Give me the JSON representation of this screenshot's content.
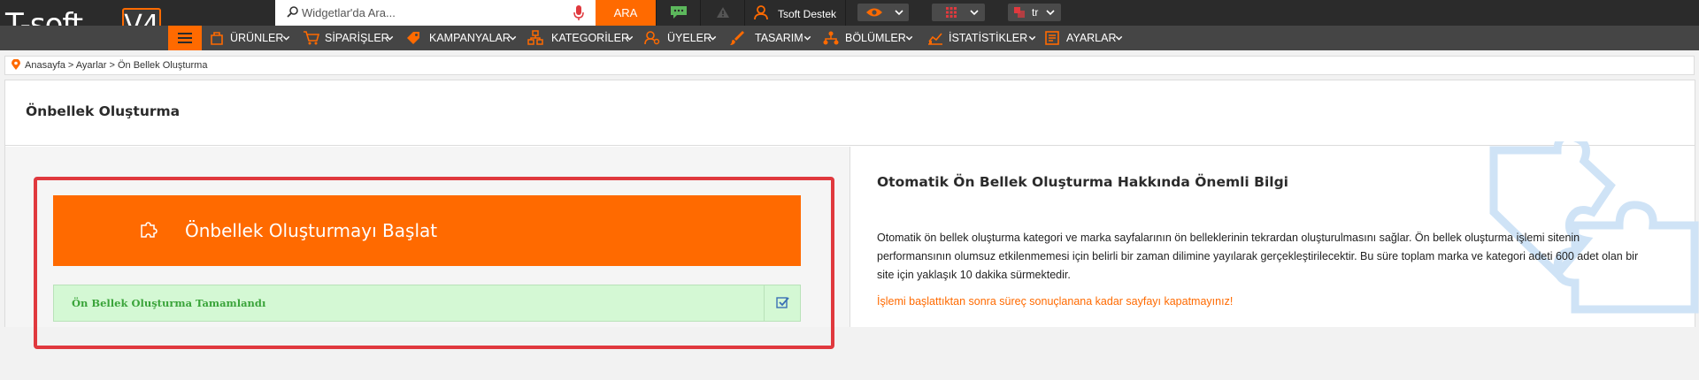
{
  "brand": {
    "logo_text": "T-soft",
    "logo_version": "V4",
    "accent_color": "#ff6a00"
  },
  "topbar": {
    "search": {
      "placeholder": "Widgetlar'da Ara...",
      "value": "",
      "button_label": "ARA"
    },
    "icons": [
      "search-icon",
      "microphone-icon",
      "chat-icon",
      "alert-icon",
      "user-icon",
      "eye-icon",
      "grid-icon",
      "language-flag-icon"
    ],
    "support_name": "Tsoft Destek",
    "language": "tr"
  },
  "nav": {
    "items": [
      {
        "label": "ÜRÜNLER",
        "icon": "products-icon"
      },
      {
        "label": "SİPARİŞLER",
        "icon": "cart-icon"
      },
      {
        "label": "KAMPANYALAR",
        "icon": "tag-icon"
      },
      {
        "label": "KATEGORİLER",
        "icon": "category-icon"
      },
      {
        "label": "ÜYELER",
        "icon": "members-icon"
      },
      {
        "label": "TASARIM",
        "icon": "design-icon"
      },
      {
        "label": "BÖLÜMLER",
        "icon": "sections-icon"
      },
      {
        "label": "İSTATİSTİKLER",
        "icon": "stats-icon"
      },
      {
        "label": "AYARLAR",
        "icon": "settings-icon"
      }
    ]
  },
  "breadcrumb": {
    "text": "Anasayfa > Ayarlar > Ön Bellek Oluşturma"
  },
  "page": {
    "title": "Önbellek Oluşturma",
    "start_button_label": "Önbellek Oluşturmayı Başlat",
    "status_text": "Ön Bellek Oluşturma Tamamlandı",
    "status_color": "#3aa43a",
    "highlight_color": "#e0393e"
  },
  "info": {
    "title": "Otomatik Ön Bellek Oluşturma Hakkında Önemli Bilgi",
    "body": "Otomatik ön bellek oluşturma kategori ve marka sayfalarının ön belleklerinin tekrardan oluşturulmasını sağlar. Ön bellek oluşturma işlemi sitenin performansının olumsuz etkilenmemesi için belirli bir zaman dilimine yayılarak gerçekleştirilecektir. Bu süre toplam marka ve kategori adeti 600 adet olan bir site için yaklaşık 10 dakika sürmektedir.",
    "warning": "İşlemi başlattıktan sonra süreç sonuçlanana kadar sayfayı kapatmayınız!"
  }
}
